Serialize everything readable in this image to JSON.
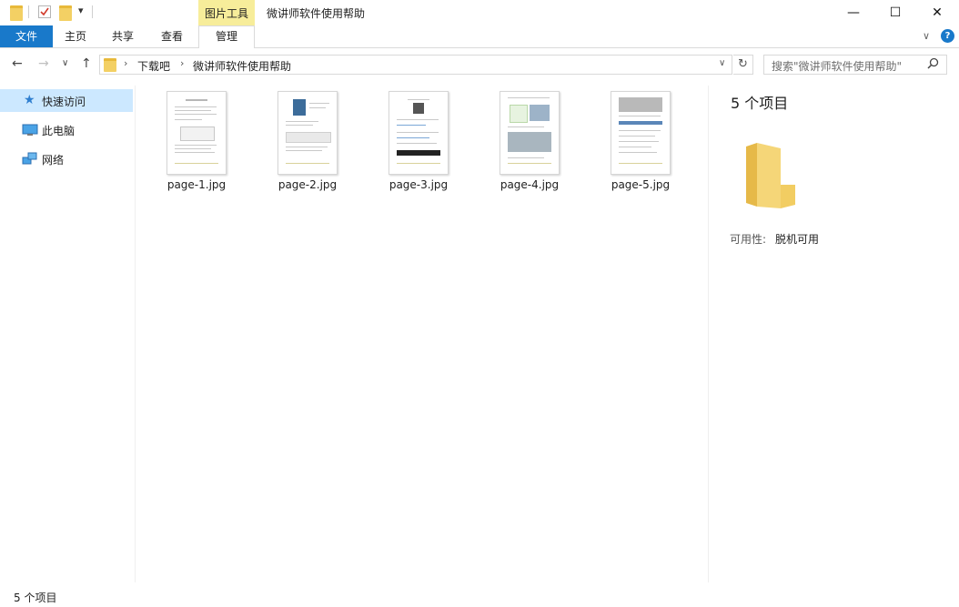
{
  "window": {
    "title": "微讲师软件使用帮助",
    "context_tab_group": "图片工具",
    "minimize": "—",
    "maximize": "☐",
    "close": "✕"
  },
  "ribbon": {
    "tabs": [
      "文件",
      "主页",
      "共享",
      "查看",
      "管理"
    ],
    "active_tab": "管理",
    "collapse_glyph": "∨",
    "help_glyph": "?"
  },
  "addressbar": {
    "back": "←",
    "forward": "→",
    "recent": "∨",
    "up": "↑",
    "breadcrumbs": [
      "下载吧",
      "微讲师软件使用帮助"
    ],
    "separator": "›",
    "dropdown": "∨",
    "refresh": "↻"
  },
  "search": {
    "placeholder": "搜索\"微讲师软件使用帮助\""
  },
  "navigation": {
    "items": [
      {
        "label": "快速访问",
        "icon": "star-icon",
        "selected": true
      },
      {
        "label": "此电脑",
        "icon": "computer-icon",
        "selected": false
      },
      {
        "label": "网络",
        "icon": "network-icon",
        "selected": false
      }
    ]
  },
  "files": [
    {
      "name": "page-1.jpg"
    },
    {
      "name": "page-2.jpg"
    },
    {
      "name": "page-3.jpg"
    },
    {
      "name": "page-4.jpg"
    },
    {
      "name": "page-5.jpg"
    }
  ],
  "details": {
    "count": "5 个项目",
    "availability_label": "可用性:",
    "availability_value": "脱机可用"
  },
  "status": {
    "text": "5 个项目"
  },
  "colors": {
    "accent": "#1979ca",
    "context_tab": "#f7ed9a",
    "selection": "#cce8ff",
    "folder": "#f3d064"
  }
}
